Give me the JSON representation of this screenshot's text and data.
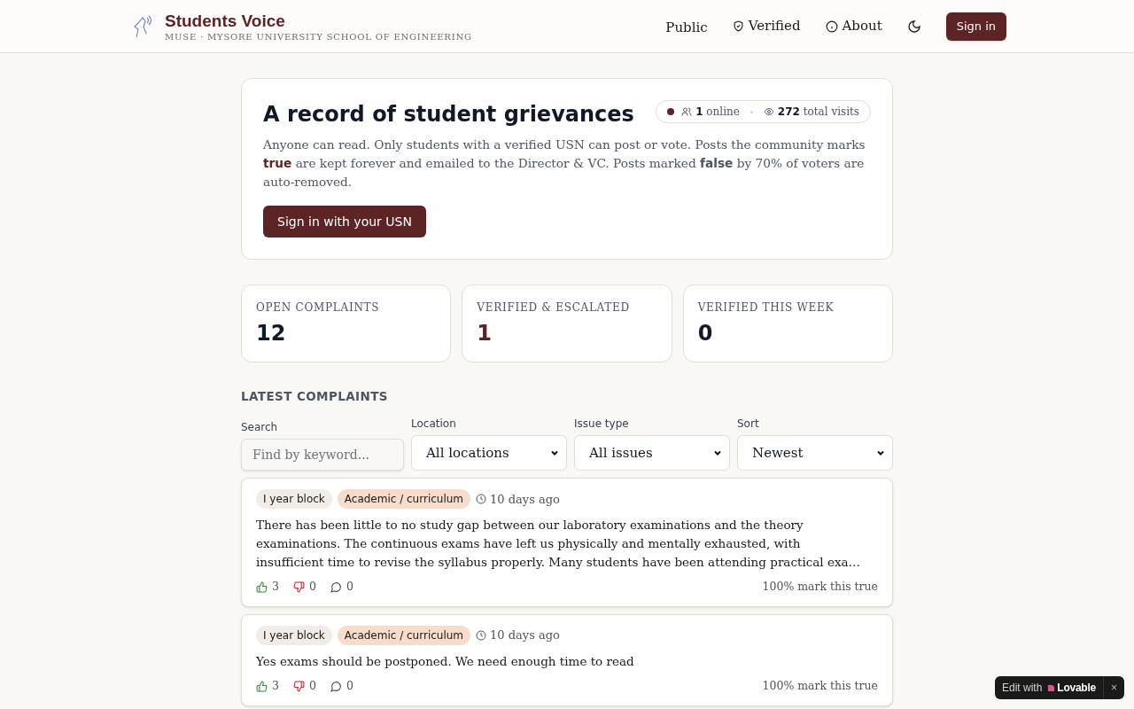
{
  "header": {
    "title": "Students Voice",
    "subtitle": "MUSE · MYSORE UNIVERSITY SCHOOL OF ENGINEERING",
    "nav": [
      {
        "label": "Public",
        "kind": "plain"
      },
      {
        "label": "Verified",
        "kind": "shield"
      },
      {
        "label": "About",
        "kind": "info"
      }
    ],
    "sign_in": "Sign in"
  },
  "hero": {
    "title": "A record of student grievances",
    "online_count": "1",
    "online_label": "online",
    "visits_count": "272",
    "visits_label": "total visits",
    "description": "Anyone can read. Only students with a verified USN can post or vote. Posts the community marks **true** are kept forever and emailed to the Director & VC. Posts marked **false** by 70% of voters are auto-removed.",
    "button": "Sign in with your USN"
  },
  "stats": [
    {
      "label": "OPEN COMPLAINTS",
      "value": "12",
      "accent": false
    },
    {
      "label": "VERIFIED & ESCALATED",
      "value": "1",
      "accent": true
    },
    {
      "label": "VERIFIED THIS WEEK",
      "value": "0",
      "accent": false
    }
  ],
  "section_title": "LATEST COMPLAINTS",
  "filters": {
    "search": {
      "label": "Search",
      "placeholder": "Find by keyword..."
    },
    "selects": [
      {
        "label": "Location",
        "value": "All locations"
      },
      {
        "label": "Issue type",
        "value": "All issues"
      },
      {
        "label": "Sort",
        "value": "Newest"
      }
    ]
  },
  "complaints": [
    {
      "location": "I year block",
      "category": "Academic / curriculum",
      "time": "10 days ago",
      "text": "There has been little to no study gap between our laboratory examinations and the theory examinations. The continuous exams have left us physically and mentally exhausted, with insufficient time to revise the syllabus properly. Many students have been attending practical exa…",
      "upvotes": "3",
      "downvotes": "0",
      "comments": "0",
      "true_share": "100% mark this true"
    },
    {
      "location": "I year block",
      "category": "Academic / curriculum",
      "time": "10 days ago",
      "text": "Yes exams should be postponed. We need enough time to read",
      "upvotes": "3",
      "downvotes": "0",
      "comments": "0",
      "true_share": "100% mark this true"
    }
  ],
  "badge": {
    "prefix": "Edit with",
    "brand": "Lovable",
    "close": "×"
  }
}
